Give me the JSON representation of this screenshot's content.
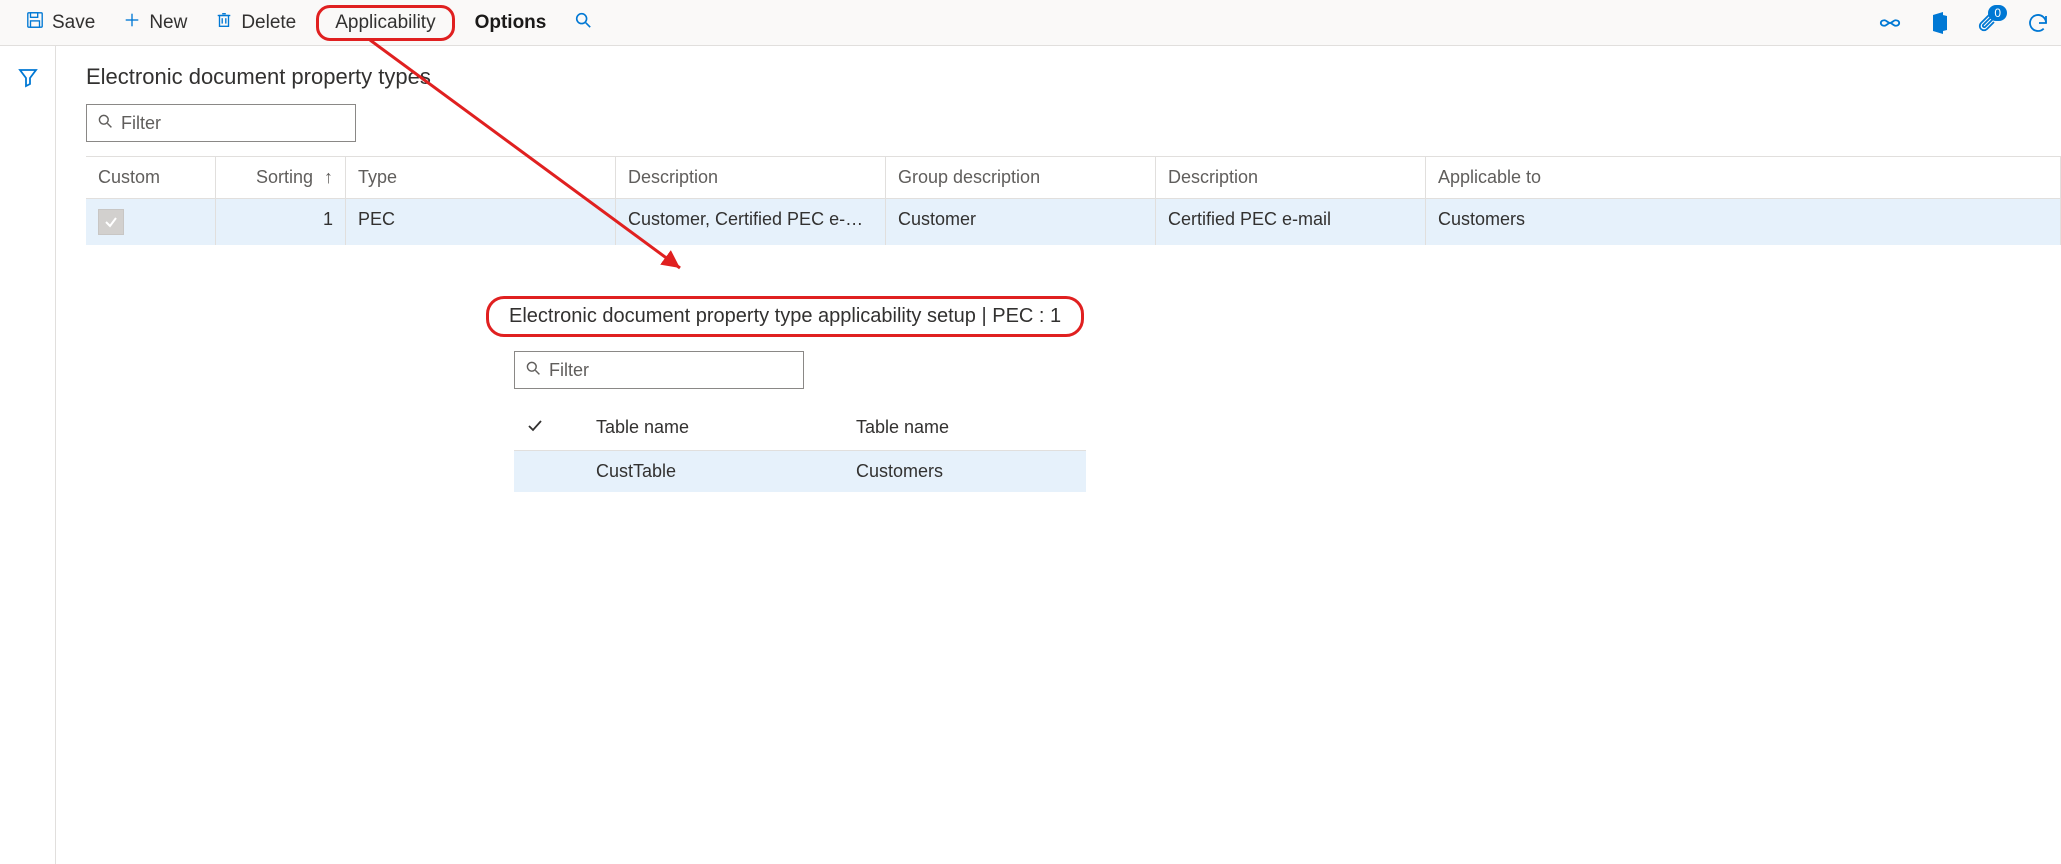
{
  "toolbar": {
    "save": "Save",
    "new": "New",
    "delete": "Delete",
    "applicability": "Applicability",
    "options": "Options",
    "notification_count": "0"
  },
  "section": {
    "title": "Electronic document property types",
    "filter_placeholder": "Filter"
  },
  "grid": {
    "headers": {
      "custom": "Custom",
      "sorting": "Sorting",
      "type": "Type",
      "description1": "Description",
      "group_description": "Group description",
      "description2": "Description",
      "applicable_to": "Applicable to"
    },
    "row": {
      "sorting": "1",
      "type": "PEC",
      "description1": "Customer, Certified PEC e-mail",
      "group_description": "Customer",
      "description2": "Certified PEC e-mail",
      "applicable_to": "Customers"
    }
  },
  "callout": {
    "title": "Electronic document property type applicability setup   |   PEC : 1",
    "filter_placeholder": "Filter",
    "headers": {
      "col1": "Table name",
      "col2": "Table name"
    },
    "row": {
      "col1": "CustTable",
      "col2": "Customers"
    }
  }
}
